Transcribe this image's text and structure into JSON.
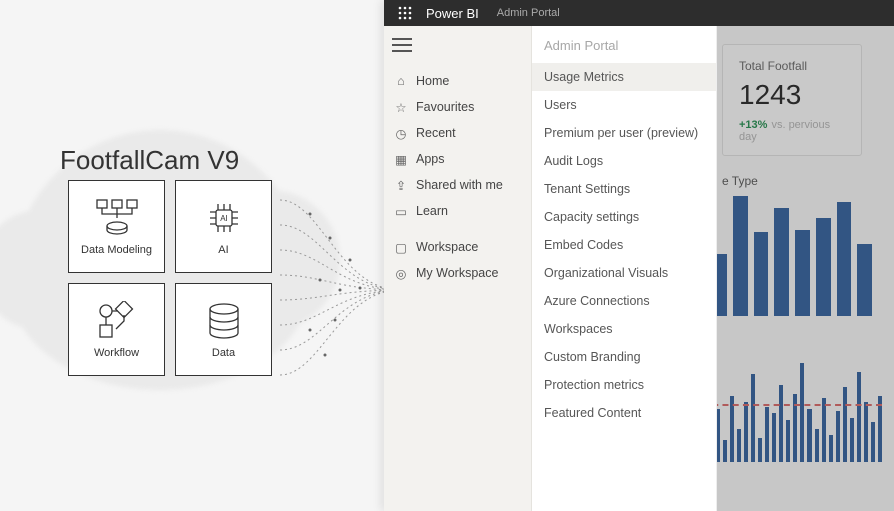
{
  "product": {
    "title": "FootfallCam V9"
  },
  "tiles": [
    {
      "label": "Data Modeling",
      "icon": "data-modeling-icon"
    },
    {
      "label": "AI",
      "icon": "ai-icon"
    },
    {
      "label": "Workflow",
      "icon": "workflow-icon"
    },
    {
      "label": "Data",
      "icon": "data-icon"
    }
  ],
  "powerbi": {
    "header": {
      "app": "Power BI",
      "section": "Admin Portal"
    },
    "nav": [
      {
        "label": "Home",
        "icon": "home-icon"
      },
      {
        "label": "Favourites",
        "icon": "star-icon"
      },
      {
        "label": "Recent",
        "icon": "clock-icon"
      },
      {
        "label": "Apps",
        "icon": "apps-icon"
      },
      {
        "label": "Shared with me",
        "icon": "share-icon"
      },
      {
        "label": "Learn",
        "icon": "book-icon"
      },
      {
        "label": "Workspace",
        "icon": "workspace-icon"
      },
      {
        "label": "My Workspace",
        "icon": "gear-icon"
      }
    ],
    "admin": {
      "title": "Admin Portal",
      "items": [
        "Usage Metrics",
        "Users",
        "Premium per user (preview)",
        "Audit Logs",
        "Tenant Settings",
        "Capacity settings",
        "Embed Codes",
        "Organizational Visuals",
        "Azure Connections",
        "Workspaces",
        "Custom Branding",
        "Protection metrics",
        "Featured Content"
      ],
      "selected": 0
    },
    "dashboard": {
      "kpi": {
        "title": "Total Footfall",
        "value": "1243",
        "delta": "+13%",
        "vs": "vs. pervious day"
      },
      "chart1": {
        "title": "e Type"
      }
    }
  },
  "chart_data": [
    {
      "type": "bar",
      "title": "e Type",
      "values": [
        52,
        100,
        70,
        90,
        72,
        82,
        95,
        60
      ],
      "ylim": [
        0,
        100
      ]
    },
    {
      "type": "bar",
      "title": "",
      "values": [
        40,
        72,
        48,
        20,
        60,
        30,
        55,
        80,
        22,
        50,
        45,
        70,
        38,
        62,
        90,
        48,
        30,
        58,
        25,
        46,
        68,
        40,
        82,
        55,
        36,
        60
      ],
      "threshold": 53,
      "ylim": [
        0,
        100
      ]
    }
  ]
}
